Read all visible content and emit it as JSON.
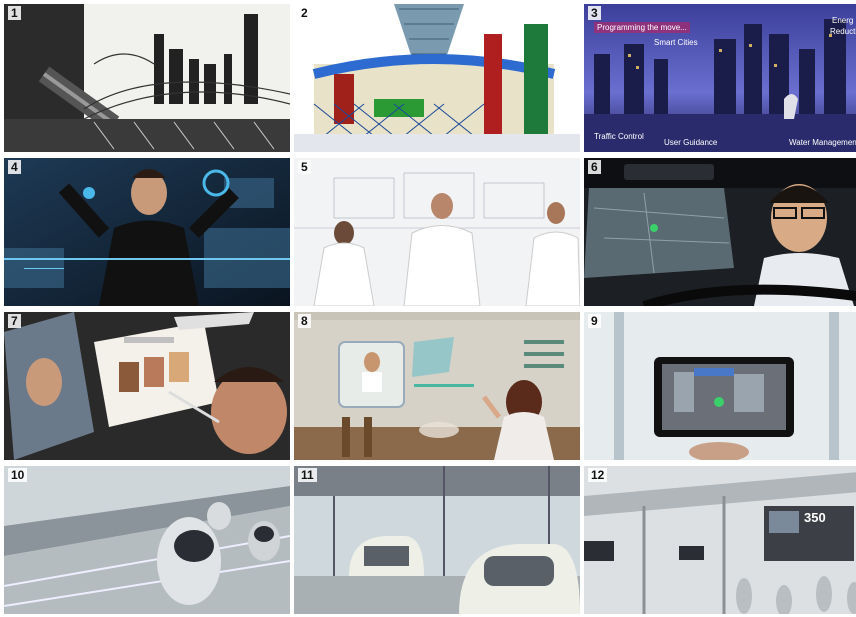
{
  "panels": [
    {
      "number": "1",
      "subject": "etching-city-skyline"
    },
    {
      "number": "2",
      "subject": "colorful-megastructure-drawing"
    },
    {
      "number": "3",
      "subject": "smart-city-night-skyline",
      "labels": {
        "top_left": "Programming the move...",
        "smart_cities": "Smart Cities",
        "energy": "Energ",
        "reduction": "Reducti",
        "traffic_control": "Traffic Control",
        "user_guidance": "User Guidance",
        "water_management": "Water Managemen"
      }
    },
    {
      "number": "4",
      "subject": "gesture-interface-man"
    },
    {
      "number": "5",
      "subject": "white-pod-workstations"
    },
    {
      "number": "6",
      "subject": "car-driver-dashboard-map"
    },
    {
      "number": "7",
      "subject": "makeup-palette-tablet"
    },
    {
      "number": "8",
      "subject": "kitchen-holographic-display"
    },
    {
      "number": "9",
      "subject": "handheld-ar-tablet"
    },
    {
      "number": "10",
      "subject": "pod-vehicles-highway"
    },
    {
      "number": "11",
      "subject": "autonomous-pod-station"
    },
    {
      "number": "12",
      "subject": "ar-street-signage",
      "labels": {
        "big_value": "350"
      }
    }
  ],
  "colors": {
    "background": "#ffffff",
    "accent_pink": "#c81e5a",
    "cyan": "#4ab8e8"
  }
}
